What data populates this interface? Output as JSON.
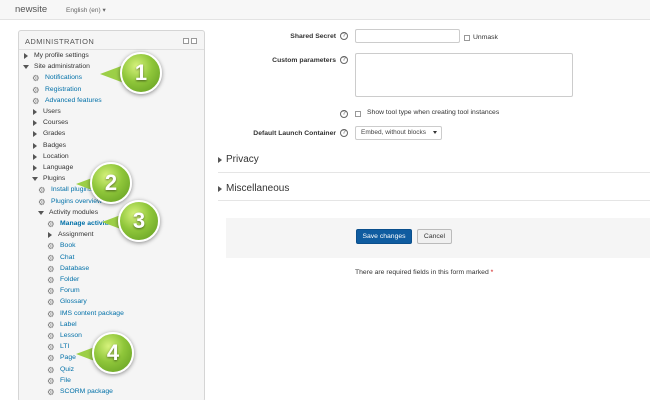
{
  "header": {
    "site_name": "newsite",
    "language": "English (en) ▾"
  },
  "admin": {
    "title": "ADMINISTRATION",
    "tree": [
      {
        "label": "My profile settings",
        "level": 0,
        "type": "collapsed"
      },
      {
        "label": "Site administration",
        "level": 0,
        "type": "expanded"
      },
      {
        "label": "Notifications",
        "level": 1,
        "type": "gear-link"
      },
      {
        "label": "Registration",
        "level": 1,
        "type": "gear-link"
      },
      {
        "label": "Advanced features",
        "level": 1,
        "type": "gear-link"
      },
      {
        "label": "Users",
        "level": 1,
        "type": "collapsed"
      },
      {
        "label": "Courses",
        "level": 1,
        "type": "collapsed"
      },
      {
        "label": "Grades",
        "level": 1,
        "type": "collapsed"
      },
      {
        "label": "Badges",
        "level": 1,
        "type": "collapsed"
      },
      {
        "label": "Location",
        "level": 1,
        "type": "collapsed"
      },
      {
        "label": "Language",
        "level": 1,
        "type": "collapsed"
      },
      {
        "label": "Plugins",
        "level": 1,
        "type": "expanded"
      },
      {
        "label": "Install plugins",
        "level": 2,
        "type": "gear-link"
      },
      {
        "label": "Plugins overview",
        "level": 2,
        "type": "gear-link"
      },
      {
        "label": "Activity modules",
        "level": 2,
        "type": "expanded"
      },
      {
        "label": "Manage activities",
        "level": 3,
        "type": "gear-bold"
      },
      {
        "label": "Assignment",
        "level": 3,
        "type": "collapsed"
      },
      {
        "label": "Book",
        "level": 3,
        "type": "gear-link"
      },
      {
        "label": "Chat",
        "level": 3,
        "type": "gear-link"
      },
      {
        "label": "Database",
        "level": 3,
        "type": "gear-link"
      },
      {
        "label": "Folder",
        "level": 3,
        "type": "gear-link"
      },
      {
        "label": "Forum",
        "level": 3,
        "type": "gear-link"
      },
      {
        "label": "Glossary",
        "level": 3,
        "type": "gear-link"
      },
      {
        "label": "IMS content package",
        "level": 3,
        "type": "gear-link"
      },
      {
        "label": "Label",
        "level": 3,
        "type": "gear-link"
      },
      {
        "label": "Lesson",
        "level": 3,
        "type": "gear-link"
      },
      {
        "label": "LTI",
        "level": 3,
        "type": "gear-link"
      },
      {
        "label": "Page",
        "level": 3,
        "type": "gear-link"
      },
      {
        "label": "Quiz",
        "level": 3,
        "type": "gear-link"
      },
      {
        "label": "File",
        "level": 3,
        "type": "gear-link"
      },
      {
        "label": "SCORM package",
        "level": 3,
        "type": "gear-link"
      }
    ]
  },
  "callouts": [
    "1",
    "2",
    "3",
    "4"
  ],
  "form": {
    "shared_secret_label": "Shared Secret",
    "shared_secret_value": "",
    "unmask_label": "Unmask",
    "custom_params_label": "Custom parameters",
    "custom_params_value": "",
    "show_tool_type_label": "Show tool type when creating tool instances",
    "default_launch_label": "Default Launch Container",
    "default_launch_value": "Embed, without blocks",
    "help_glyph": "?"
  },
  "sections": {
    "privacy": "Privacy",
    "misc": "Miscellaneous"
  },
  "buttons": {
    "save": "Save changes",
    "cancel": "Cancel"
  },
  "required_note": {
    "text": "There are required fields in this form marked",
    "star": "*"
  }
}
